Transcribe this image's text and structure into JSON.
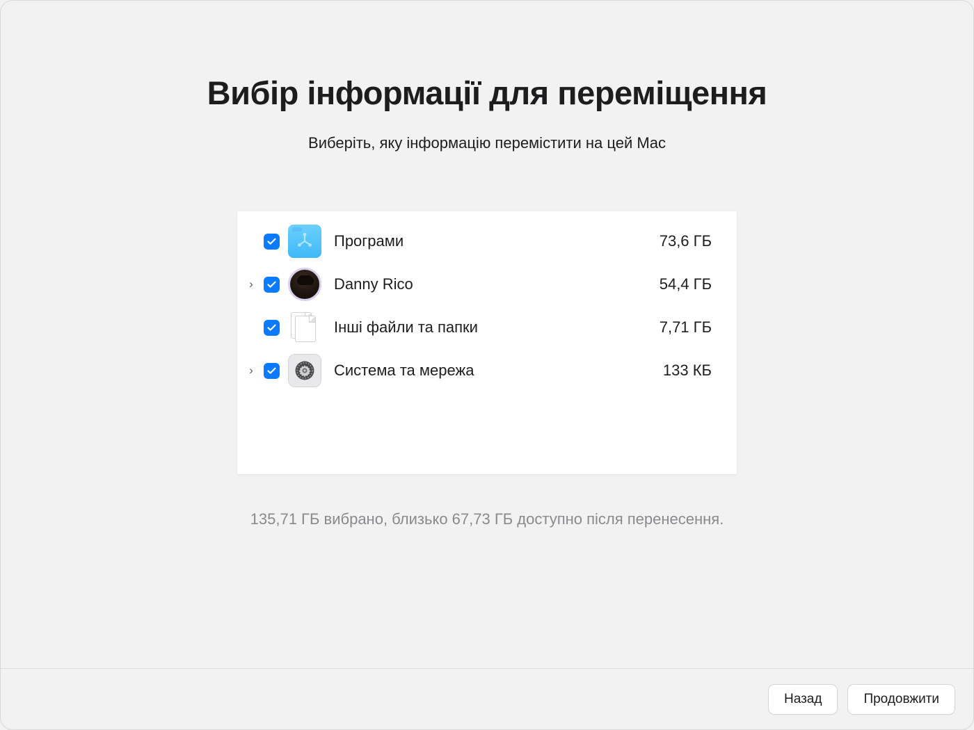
{
  "title": "Вибір інформації для переміщення",
  "subtitle": "Виберіть, яку інформацію перемістити на цей Mac",
  "items": [
    {
      "label": "Програми",
      "size": "73,6 ГБ",
      "checked": true,
      "expandable": false,
      "icon": "applications-folder-icon"
    },
    {
      "label": "Danny Rico",
      "size": "54,4 ГБ",
      "checked": true,
      "expandable": true,
      "icon": "user-avatar-icon"
    },
    {
      "label": "Інші файли та папки",
      "size": "7,71 ГБ",
      "checked": true,
      "expandable": false,
      "icon": "documents-icon"
    },
    {
      "label": "Система та мережа",
      "size": "133 КБ",
      "checked": true,
      "expandable": true,
      "icon": "system-settings-icon"
    }
  ],
  "summary": "135,71 ГБ вибрано, близько 67,73 ГБ доступно після перенесення.",
  "buttons": {
    "back": "Назад",
    "continue": "Продовжити"
  }
}
